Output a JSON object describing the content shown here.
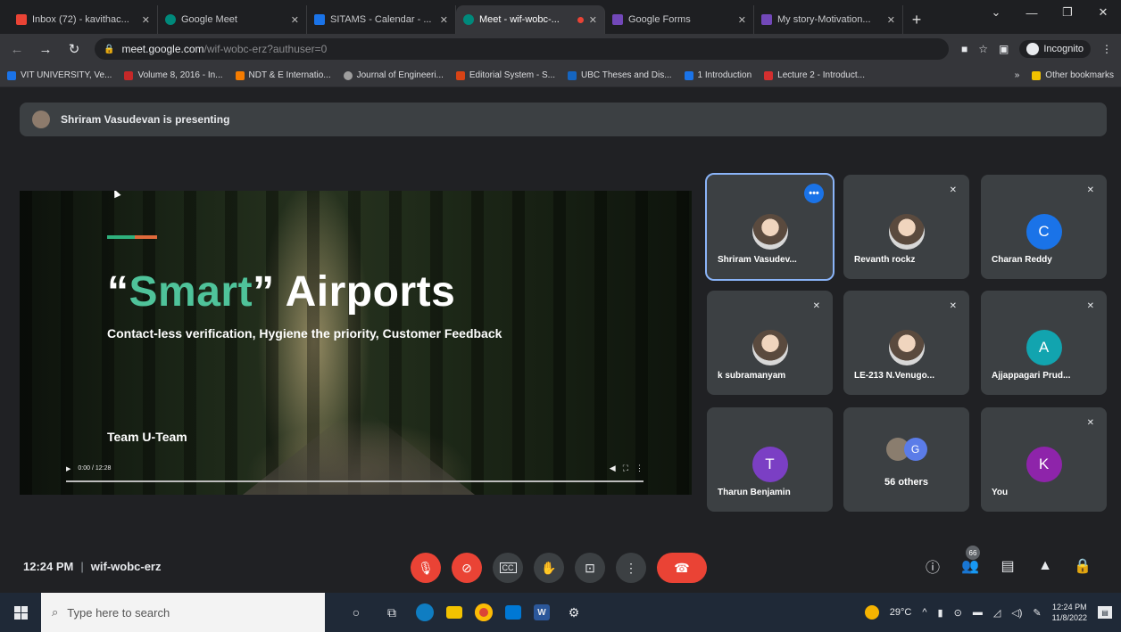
{
  "browser": {
    "tabs": [
      {
        "title": "Inbox (72) - kavithac...",
        "color": "#ea4335"
      },
      {
        "title": "Google Meet",
        "color": "#00897b"
      },
      {
        "title": "SITAMS - Calendar - ...",
        "color": "#1a73e8"
      },
      {
        "title": "Meet - wif-wobc-...",
        "color": "#00897b",
        "active": true
      },
      {
        "title": "Google Forms",
        "color": "#7248b9"
      },
      {
        "title": "My story-Motivation...",
        "color": "#7248b9"
      }
    ],
    "url_host": "meet.google.com",
    "url_path": "/wif-wobc-erz?authuser=0",
    "incognito_label": "Incognito",
    "bookmarks": [
      {
        "label": "VIT UNIVERSITY, Ve...",
        "color": "#1a73e8"
      },
      {
        "label": "Volume 8, 2016 - In...",
        "color": "#c62828"
      },
      {
        "label": "NDT & E Internatio...",
        "color": "#f57c00"
      },
      {
        "label": "Journal of Engineeri...",
        "color": "#9e9e9e"
      },
      {
        "label": "Editorial System - S...",
        "color": "#d84315"
      },
      {
        "label": "UBC Theses and Dis...",
        "color": "#1565c0"
      },
      {
        "label": "1 Introduction",
        "color": "#1a73e8"
      },
      {
        "label": "Lecture 2 - Introduct...",
        "color": "#d32f2f"
      }
    ],
    "other_bookmarks": "Other bookmarks"
  },
  "meet": {
    "presenting_banner": "Shriram Vasudevan is presenting",
    "slide": {
      "quote_open": "“",
      "word_smart": "Smart",
      "quote_close": "”",
      "word_airports": " Airports",
      "subtitle": "Contact-less verification, Hygiene the priority, Customer Feedback",
      "team": "Team U-Team",
      "video_time": "0:00 / 12:28",
      "accent_colors": [
        "#2fb17d",
        "#e06a3b"
      ]
    },
    "participants": [
      {
        "name": "Shriram Vasudev...",
        "avatar": "photo",
        "speaking": true
      },
      {
        "name": "Revanth rockz",
        "avatar": "photo",
        "muted": true
      },
      {
        "name": "Charan Reddy",
        "avatar": "C",
        "avatar_color": "#1a73e8",
        "muted": true
      },
      {
        "name": "k subramanyam",
        "avatar": "photo",
        "muted": true
      },
      {
        "name": "LE-213 N.Venugo...",
        "avatar": "photo",
        "muted": true
      },
      {
        "name": "Ajjappagari Prud...",
        "avatar": "A",
        "avatar_color": "#12a4af",
        "muted": true
      },
      {
        "name": "Tharun Benjamin",
        "avatar": "T",
        "avatar_color": "#7b3fc4"
      },
      {
        "name": "56 others",
        "avatar": "G",
        "avatar_color": "#5b7ce8"
      },
      {
        "name": "You",
        "avatar": "K",
        "avatar_color": "#8e24aa",
        "muted": true
      }
    ],
    "time": "12:24 PM",
    "meeting_code": "wif-wobc-erz",
    "people_count": "66"
  },
  "taskbar": {
    "search_placeholder": "Type here to search",
    "temperature": "29°C",
    "clock_time": "12:24 PM",
    "clock_date": "11/8/2022"
  }
}
